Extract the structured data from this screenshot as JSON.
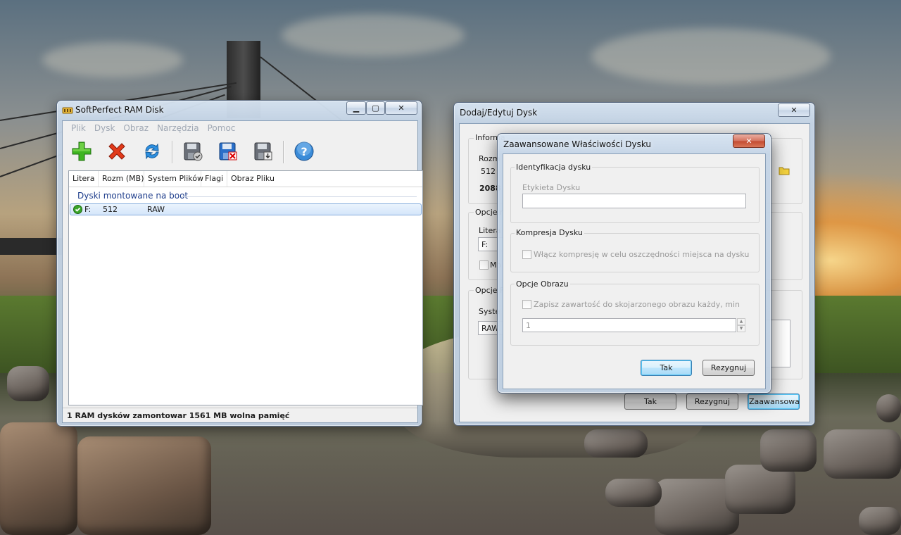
{
  "main_window": {
    "title": "SoftPerfect RAM Disk",
    "menu": [
      "Plik",
      "Dysk",
      "Obraz",
      "Narzędzia",
      "Pomoc"
    ],
    "toolbar": {
      "icons": [
        "add-disk-icon",
        "remove-disk-icon",
        "refresh-icon",
        "save-image-icon",
        "delete-image-icon",
        "load-image-icon",
        "help-icon"
      ]
    },
    "columns": [
      "Litera",
      "Rozm (MB)",
      "System Plików",
      "Flagi",
      "Obraz Pliku"
    ],
    "group_label": "Dyski montowane na boot",
    "rows": [
      {
        "letter": "F:",
        "size": "512",
        "fs": "RAW",
        "flags": "",
        "image": ""
      }
    ],
    "status": "1 RAM dysków zamontowar 1561 MB wolna pamięć"
  },
  "edit_dialog": {
    "title": "Dodaj/Edytuj Dysk",
    "group1": "Informa",
    "size_label": "Rozm",
    "size_value": "512",
    "free_value": "2088",
    "group2": "Opcje m",
    "letter_label": "Litera",
    "letter_value": "F:",
    "mount_label": "Mo",
    "group3": "Opcje F",
    "fs_label": "Syste",
    "fs_value": "RAW",
    "ok": "Tak",
    "cancel": "Rezygnuj",
    "advanced": "Zaawansowane"
  },
  "advanced_dialog": {
    "title": "Zaawansowane Właściwości Dysku",
    "ident_group": "Identyfikacja dysku",
    "label_caption": "Etykieta Dysku",
    "label_value": "",
    "compress_group": "Kompresja Dysku",
    "compress_check": "Włącz kompresję w celu oszczędności miejsca na dysku",
    "image_group": "Opcje Obrazu",
    "image_check": "Zapisz zawartość do skojarzonego obrazu każdy, min",
    "interval_value": "1",
    "ok": "Tak",
    "cancel": "Rezygnuj"
  },
  "colors": {
    "group_text": "#1f3e8c",
    "selection": "#d5e6fa",
    "close_button": "#c34a30"
  }
}
